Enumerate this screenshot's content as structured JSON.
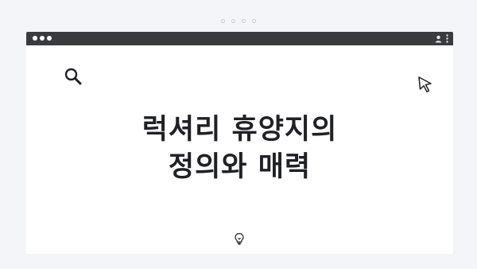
{
  "window": {
    "title_dots": [
      "top-dot-1",
      "top-dot-2",
      "top-dot-3",
      "top-dot-4"
    ],
    "traffic_lights": [
      "light-1",
      "light-2",
      "light-3"
    ],
    "icons": {
      "user": "user-icon",
      "menu": "vertical-dots-menu-icon",
      "search": "search-icon",
      "cursor": "mouse-pointer-icon",
      "bulb": "lightbulb-icon"
    }
  },
  "headline": {
    "line1": "럭셔리 휴양지의",
    "line2": "정의와 매력"
  },
  "colors": {
    "page_background": "#f3f5f8",
    "titlebar": "#3a3b3e",
    "window_background": "#ffffff",
    "text": "#202124"
  }
}
